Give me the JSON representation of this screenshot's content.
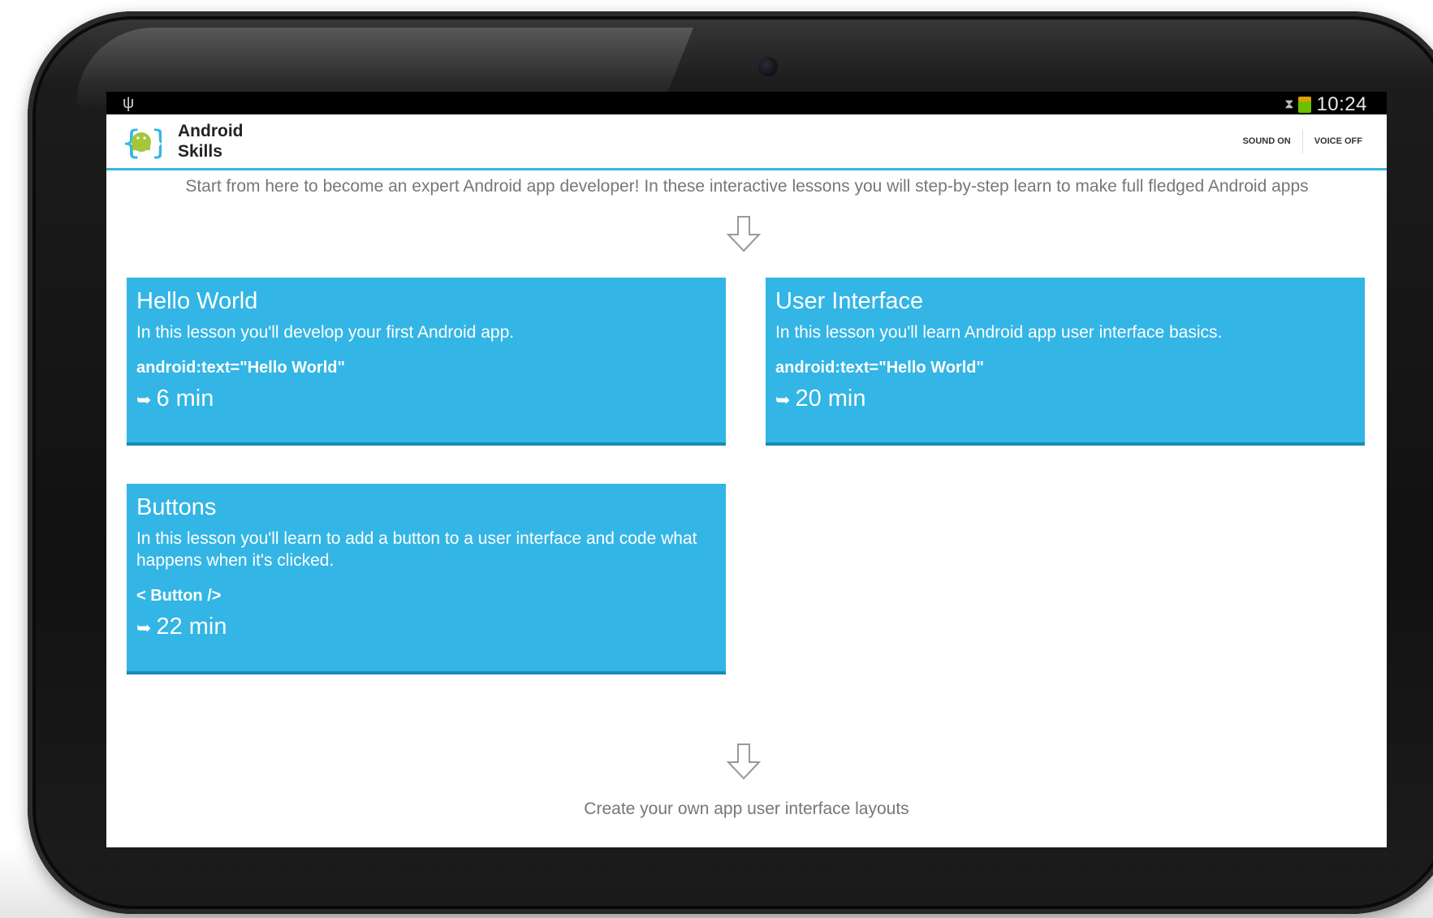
{
  "status_bar": {
    "time": "10:24"
  },
  "action_bar": {
    "app_title_line1": "Android",
    "app_title_line2": "Skills",
    "sound_button": "SOUND ON",
    "voice_button": "VOICE OFF"
  },
  "intro_text": "Start from here to become an expert Android app developer! In these interactive lessons you will step-by-step learn to make full fledged Android apps",
  "lessons": [
    {
      "title": "Hello World",
      "description": "In this lesson you'll develop your first Android app.",
      "code": "android:text=\"Hello World\"",
      "duration": "6 min"
    },
    {
      "title": "User Interface",
      "description": "In this lesson you'll learn Android app user interface basics.",
      "code": "android:text=\"Hello World\"",
      "duration": "20 min"
    },
    {
      "title": "Buttons",
      "description": "In this lesson you'll learn to add a button to a user interface and code what happens when it's clicked.",
      "code": "< Button />",
      "duration": "22 min"
    }
  ],
  "footer_text": "Create your own app user interface layouts",
  "colors": {
    "card_blue": "#33b5e5",
    "accent_line": "#33b5e5"
  }
}
